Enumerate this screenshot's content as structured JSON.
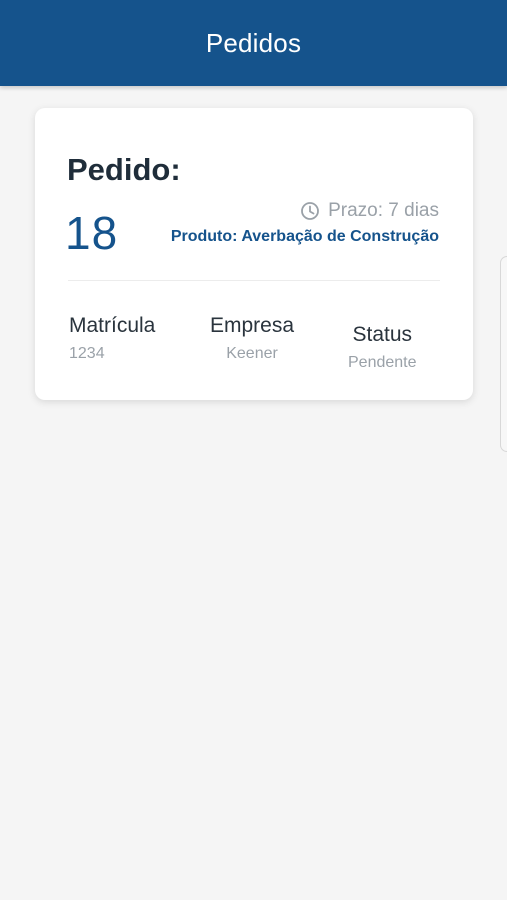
{
  "header": {
    "title": "Pedidos"
  },
  "order": {
    "heading": "Pedido:",
    "number": "18",
    "deadline": "Prazo: 7 dias",
    "product": "Produto: Averbação de Construção"
  },
  "details": {
    "matricula_label": "Matrícula",
    "matricula_value": "1234",
    "empresa_label": "Empresa",
    "empresa_value": "Keener",
    "status_label": "Status",
    "status_value": "Pendente"
  },
  "icons": {
    "deadline": "clock-icon"
  },
  "colors": {
    "primary": "#15538c",
    "background": "#f5f5f5",
    "card": "#ffffff",
    "muted_text": "#9aa1a8",
    "dark_text": "#1f2d3a"
  }
}
